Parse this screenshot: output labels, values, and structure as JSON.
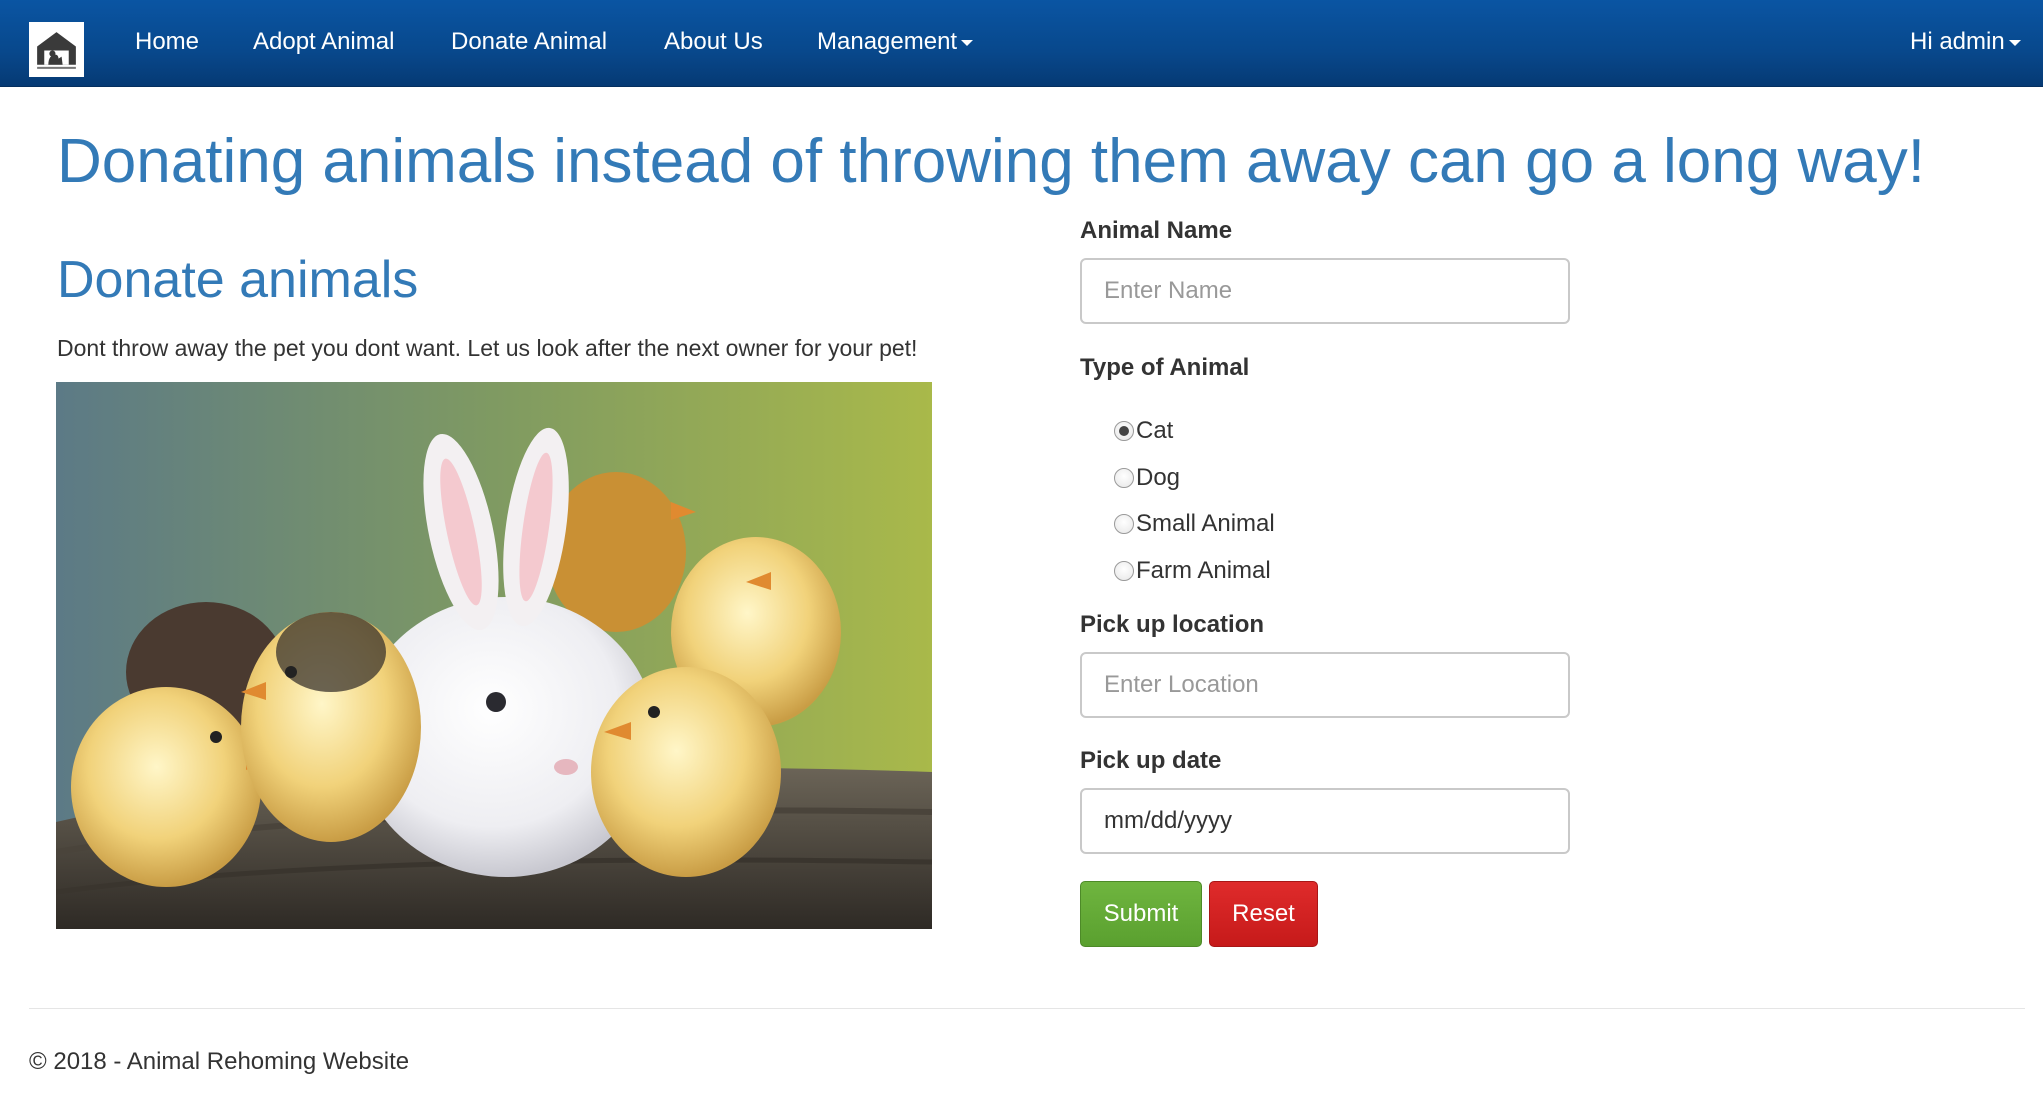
{
  "navbar": {
    "logo_icon": "animal-shelter-logo-icon",
    "items": [
      {
        "label": "Home"
      },
      {
        "label": "Adopt Animal"
      },
      {
        "label": "Donate Animal"
      },
      {
        "label": "About Us"
      },
      {
        "label": "Management"
      }
    ],
    "user_label": "Hi admin",
    "colors": {
      "background": "#0a55a3",
      "text": "#ffffff"
    }
  },
  "main": {
    "headline": "Donating animals instead of throwing them away can go a long way!",
    "section_title": "Donate animals",
    "description": "Dont throw away the pet you dont want. Let us look after the next owner for your pet!",
    "image_subject": "white rabbit with yellow chicks on a tree stump"
  },
  "form": {
    "name_label": "Animal Name",
    "name_placeholder": "Enter Name",
    "type_label": "Type of Animal",
    "types": [
      {
        "label": "Cat",
        "checked": true
      },
      {
        "label": "Dog",
        "checked": false
      },
      {
        "label": "Small Animal",
        "checked": false
      },
      {
        "label": "Farm Animal",
        "checked": false
      }
    ],
    "location_label": "Pick up location",
    "location_placeholder": "Enter Location",
    "date_label": "Pick up date",
    "date_placeholder": "mm/dd/yyyy",
    "submit_label": "Submit",
    "reset_label": "Reset",
    "colors": {
      "accent": "#337ab7",
      "submit": "#5aa02f",
      "reset": "#c61a1a"
    }
  },
  "footer": {
    "text": "© 2018 - Animal Rehoming Website"
  }
}
